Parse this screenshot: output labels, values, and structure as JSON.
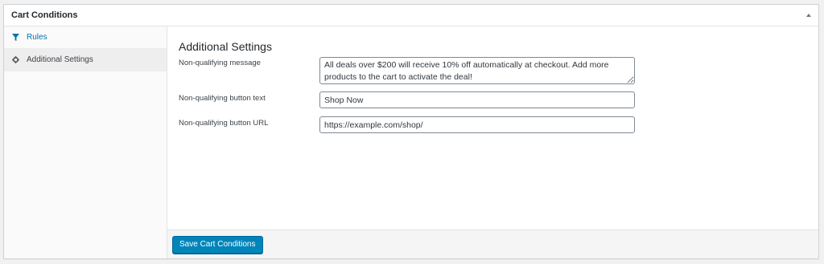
{
  "panel": {
    "title": "Cart Conditions"
  },
  "sidebar": {
    "items": [
      {
        "label": "Rules",
        "icon": "filter-icon"
      },
      {
        "label": "Additional Settings",
        "icon": "gear-icon"
      }
    ]
  },
  "main": {
    "heading": "Additional Settings",
    "fields": [
      {
        "label": "Non-qualifying message",
        "value": "All deals over $200 will receive 10% off automatically at checkout. Add more products to the cart to activate the deal!"
      },
      {
        "label": "Non-qualifying button text",
        "value": "Shop Now"
      },
      {
        "label": "Non-qualifying button URL",
        "value": "https://example.com/shop/"
      }
    ]
  },
  "footer": {
    "save_label": "Save Cart Conditions"
  },
  "colors": {
    "accent": "#0085ba",
    "link": "#0073aa"
  }
}
